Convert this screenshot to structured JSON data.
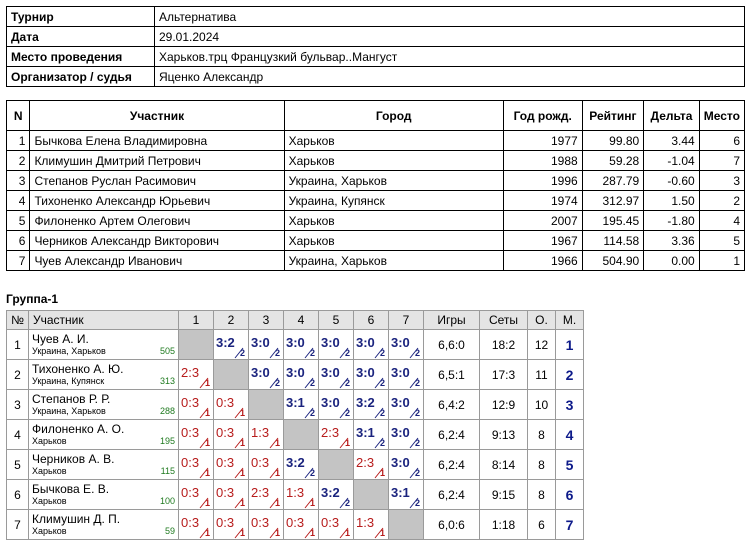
{
  "info": [
    {
      "label": "Турнир",
      "value": "Альтернатива"
    },
    {
      "label": "Дата",
      "value": "29.01.2024"
    },
    {
      "label": "Место проведения",
      "value": "Харьков.трц Французкий бульвар..Мангуст"
    },
    {
      "label": "Организатор / судья",
      "value": "Яценко Александр"
    }
  ],
  "participants": {
    "headers": [
      "N",
      "Участник",
      "Город",
      "Год рожд.",
      "Рейтинг",
      "Дельта",
      "Место"
    ],
    "rows": [
      [
        "1",
        "Бычкова Елена Владимировна",
        "Харьков",
        "1977",
        "99.80",
        "3.44",
        "6"
      ],
      [
        "2",
        "Климушин Дмитрий Петрович",
        "Харьков",
        "1988",
        "59.28",
        "-1.04",
        "7"
      ],
      [
        "3",
        "Степанов Руслан Расимович",
        "Украина, Харьков",
        "1996",
        "287.79",
        "-0.60",
        "3"
      ],
      [
        "4",
        "Тихоненко Александр Юрьевич",
        "Украина, Купянск",
        "1974",
        "312.97",
        "1.50",
        "2"
      ],
      [
        "5",
        "Филоненко Артем Олегович",
        "Харьков",
        "2007",
        "195.45",
        "-1.80",
        "4"
      ],
      [
        "6",
        "Черников Александр Викторович",
        "Харьков",
        "1967",
        "114.58",
        "3.36",
        "5"
      ],
      [
        "7",
        "Чуев Александр Иванович",
        "Украина, Харьков",
        "1966",
        "504.90",
        "0.00",
        "1"
      ]
    ]
  },
  "group": {
    "title": "Группа-1",
    "headers": [
      "№",
      "Участник",
      "1",
      "2",
      "3",
      "4",
      "5",
      "6",
      "7",
      "Игры",
      "Сеты",
      "О.",
      "М."
    ],
    "rows": [
      {
        "num": "1",
        "name": "Чуев А. И.",
        "city": "Украина, Харьков",
        "rating": "505",
        "cells": [
          null,
          {
            "s": "3:2",
            "p": "2"
          },
          {
            "s": "3:0",
            "p": "2"
          },
          {
            "s": "3:0",
            "p": "2"
          },
          {
            "s": "3:0",
            "p": "2"
          },
          {
            "s": "3:0",
            "p": "2"
          },
          {
            "s": "3:0",
            "p": "2"
          }
        ],
        "games": "6,6:0",
        "sets": "18:2",
        "points": "12",
        "place": "1"
      },
      {
        "num": "2",
        "name": "Тихоненко А. Ю.",
        "city": "Украина, Купянск",
        "rating": "313",
        "cells": [
          {
            "s": "2:3",
            "p": "1"
          },
          null,
          {
            "s": "3:0",
            "p": "2"
          },
          {
            "s": "3:0",
            "p": "2"
          },
          {
            "s": "3:0",
            "p": "2"
          },
          {
            "s": "3:0",
            "p": "2"
          },
          {
            "s": "3:0",
            "p": "2"
          }
        ],
        "games": "6,5:1",
        "sets": "17:3",
        "points": "11",
        "place": "2"
      },
      {
        "num": "3",
        "name": "Степанов Р. Р.",
        "city": "Украина, Харьков",
        "rating": "288",
        "cells": [
          {
            "s": "0:3",
            "p": "1"
          },
          {
            "s": "0:3",
            "p": "1"
          },
          null,
          {
            "s": "3:1",
            "p": "2"
          },
          {
            "s": "3:0",
            "p": "2"
          },
          {
            "s": "3:2",
            "p": "2"
          },
          {
            "s": "3:0",
            "p": "2"
          }
        ],
        "games": "6,4:2",
        "sets": "12:9",
        "points": "10",
        "place": "3"
      },
      {
        "num": "4",
        "name": "Филоненко А. О.",
        "city": "Харьков",
        "rating": "195",
        "cells": [
          {
            "s": "0:3",
            "p": "1"
          },
          {
            "s": "0:3",
            "p": "1"
          },
          {
            "s": "1:3",
            "p": "1"
          },
          null,
          {
            "s": "2:3",
            "p": "1"
          },
          {
            "s": "3:1",
            "p": "2"
          },
          {
            "s": "3:0",
            "p": "2"
          }
        ],
        "games": "6,2:4",
        "sets": "9:13",
        "points": "8",
        "place": "4"
      },
      {
        "num": "5",
        "name": "Черников А. В.",
        "city": "Харьков",
        "rating": "115",
        "cells": [
          {
            "s": "0:3",
            "p": "1"
          },
          {
            "s": "0:3",
            "p": "1"
          },
          {
            "s": "0:3",
            "p": "1"
          },
          {
            "s": "3:2",
            "p": "2"
          },
          null,
          {
            "s": "2:3",
            "p": "1"
          },
          {
            "s": "3:0",
            "p": "2"
          }
        ],
        "games": "6,2:4",
        "sets": "8:14",
        "points": "8",
        "place": "5"
      },
      {
        "num": "6",
        "name": "Бычкова Е. В.",
        "city": "Харьков",
        "rating": "100",
        "cells": [
          {
            "s": "0:3",
            "p": "1"
          },
          {
            "s": "0:3",
            "p": "1"
          },
          {
            "s": "2:3",
            "p": "1"
          },
          {
            "s": "1:3",
            "p": "1"
          },
          {
            "s": "3:2",
            "p": "2"
          },
          null,
          {
            "s": "3:1",
            "p": "2"
          }
        ],
        "games": "6,2:4",
        "sets": "9:15",
        "points": "8",
        "place": "6"
      },
      {
        "num": "7",
        "name": "Климушин Д. П.",
        "city": "Харьков",
        "rating": "59",
        "cells": [
          {
            "s": "0:3",
            "p": "1"
          },
          {
            "s": "0:3",
            "p": "1"
          },
          {
            "s": "0:3",
            "p": "1"
          },
          {
            "s": "0:3",
            "p": "1"
          },
          {
            "s": "0:3",
            "p": "1"
          },
          {
            "s": "1:3",
            "p": "1"
          },
          null
        ],
        "games": "6,0:6",
        "sets": "1:18",
        "points": "6",
        "place": "7"
      }
    ]
  }
}
